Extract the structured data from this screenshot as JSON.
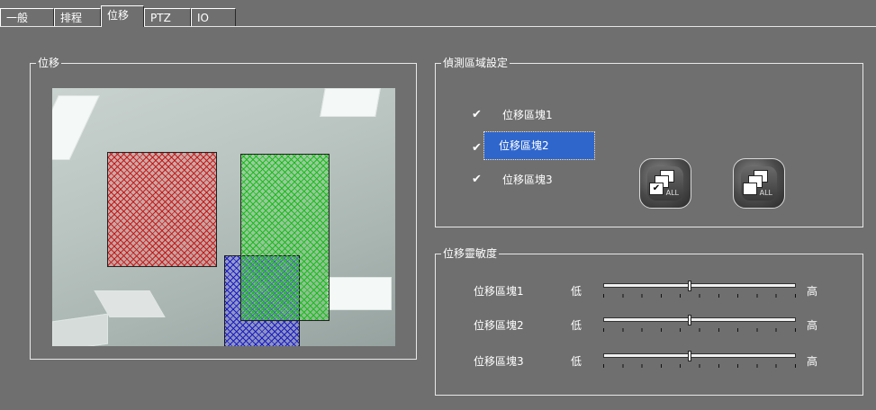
{
  "tabs": [
    {
      "label": "一般"
    },
    {
      "label": "排程"
    },
    {
      "label": "位移"
    },
    {
      "label": "PTZ"
    },
    {
      "label": "IO"
    }
  ],
  "motion_group": {
    "title": "位移"
  },
  "detection_group": {
    "title": "偵測區域設定",
    "regions": [
      {
        "label": "位移區塊1",
        "checked": true
      },
      {
        "label": "位移區塊2",
        "checked": true,
        "selected": true
      },
      {
        "label": "位移區塊3",
        "checked": true
      }
    ],
    "check_mark": "✔",
    "select_all_text": "ALL",
    "deselect_all_text": "ALL"
  },
  "sensitivity_group": {
    "title": "位移靈敏度",
    "low_label": "低",
    "high_label": "高",
    "rows": [
      {
        "label": "位移區塊1",
        "value": 0.45
      },
      {
        "label": "位移區塊2",
        "value": 0.45
      },
      {
        "label": "位移區塊3",
        "value": 0.45
      }
    ]
  }
}
